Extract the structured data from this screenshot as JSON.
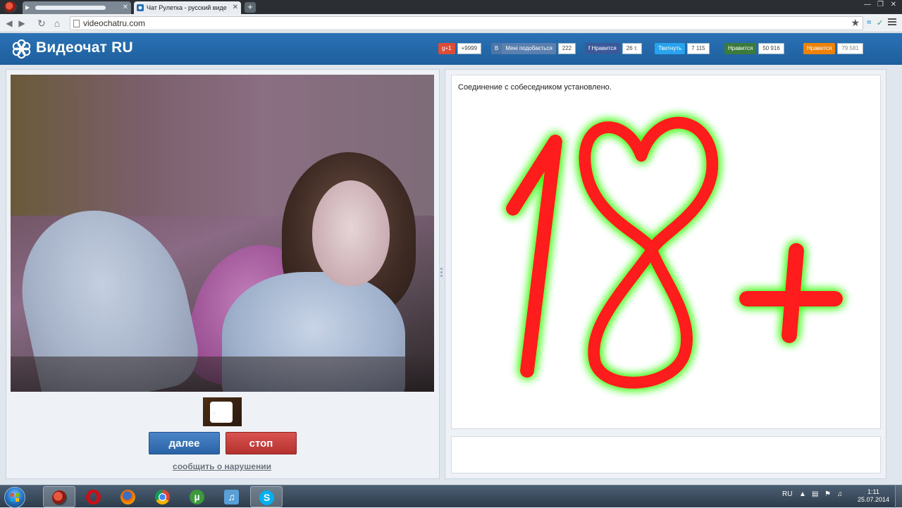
{
  "browser": {
    "tabs": [
      {
        "label": "",
        "active": false
      },
      {
        "label": "Чат Рулетка - русский виде",
        "active": true
      }
    ],
    "url": "videochatru.com"
  },
  "site": {
    "logo": "Видеочат RU",
    "social": [
      {
        "label": "g+1",
        "count": "+9999",
        "color": "#dd4b39"
      },
      {
        "label": "В",
        "color": "#4a76a8"
      },
      {
        "label": "Мені подобається",
        "count": "222",
        "color": "#5b80b0"
      },
      {
        "label": "f Нравится",
        "count": "26 т.",
        "color": "#3b5998"
      },
      {
        "label": "Твитнуть",
        "count": "7 115",
        "color": "#2aa3ef"
      },
      {
        "label": "Нравится",
        "count": "50 916",
        "color": "#3a7a3a"
      },
      {
        "label": "Нравится",
        "count": "79 581",
        "color": "#ee8208"
      }
    ],
    "buttons": {
      "next": "далее",
      "stop": "стоп"
    },
    "report": "сообщить о нарушении",
    "chat_message": "Соединение с собеседником установлено."
  },
  "overlay": {
    "text": "18+",
    "color": "#ff1a1a",
    "glow": "#39ff14"
  },
  "taskbar": {
    "apps": [
      "browser-icon",
      "opera-icon",
      "firefox-icon",
      "chrome-icon",
      "utorrent-icon",
      "music-icon",
      "skype-icon"
    ],
    "lang": "RU",
    "time": "1:11",
    "date": "25.07.2014"
  }
}
